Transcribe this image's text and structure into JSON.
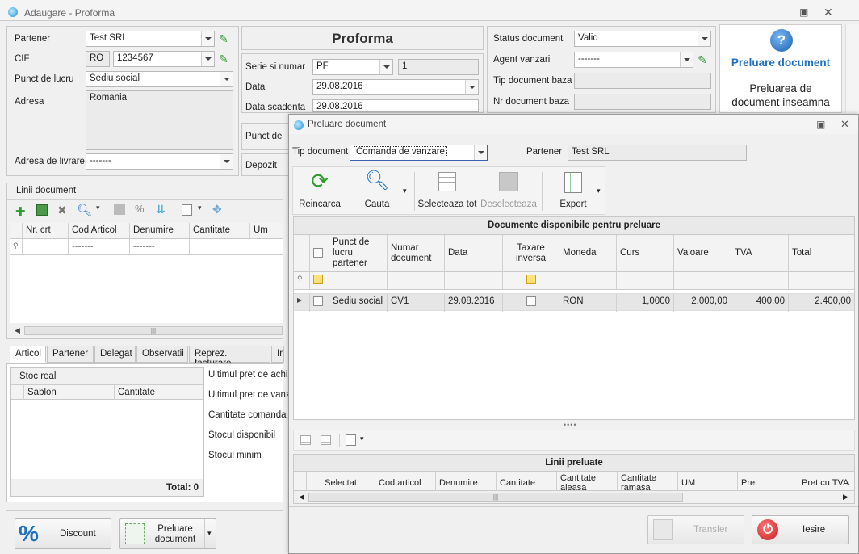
{
  "main": {
    "title": "Adaugare - Proforma",
    "partener_label": "Partener",
    "partener_value": "Test SRL",
    "cif_label": "CIF",
    "cif_prefix": "RO",
    "cif_value": "1234567",
    "punct_label": "Punct de lucru",
    "punct_value": "Sediu social",
    "adresa_label": "Adresa",
    "adresa_value": "Romania",
    "livrare_label": "Adresa de livrare",
    "livrare_value": "-------",
    "doc_title": "Proforma",
    "serie_label": "Serie si numar",
    "serie_value": "PF",
    "numar_value": "1",
    "data_label": "Data",
    "data_value": "29.08.2016",
    "scadenta_label": "Data scadenta",
    "scadenta_value": "29.08.2016",
    "punct_de_label": "Punct de",
    "depozit_label": "Depozit",
    "status_label": "Status document",
    "status_value": "Valid",
    "agent_label": "Agent vanzari",
    "agent_value": "-------",
    "tip_baza_label": "Tip document baza",
    "nr_baza_label": "Nr document baza",
    "help_title": "Preluare document",
    "help_text_1": "Preluarea de",
    "help_text_2": "document inseamna",
    "linii_label": "Linii document",
    "grid_cols": [
      "Nr. crt",
      "Cod Articol",
      "Denumire",
      "Cantitate",
      "Um"
    ],
    "grid_filter": [
      "-------",
      "-------"
    ],
    "tabs": [
      "Articol",
      "Partener",
      "Delegat",
      "Observatii",
      "Reprez. facturare",
      "Ir"
    ],
    "stoc_real": "Stoc real",
    "stoc_cols": [
      "Sablon",
      "Cantitate"
    ],
    "total_label": "Total: 0",
    "info_labels": [
      "Ultimul pret de achiz",
      "Ultimul pret de vanz",
      "Cantitate comanda",
      "Stocul disponibil",
      "Stocul minim"
    ],
    "discount_label": "Discount",
    "preluare_btn_1": "Preluare",
    "preluare_btn_2": "document"
  },
  "dialog": {
    "title": "Preluare document",
    "tip_label": "Tip document",
    "tip_value": "Comanda de vanzare",
    "partener_label": "Partener",
    "partener_value": "Test SRL",
    "toolbar": [
      "Reincarca",
      "Cauta",
      "Selecteaza tot",
      "Deselecteaza",
      "Export"
    ],
    "grid_title": "Documente disponibile pentru preluare",
    "cols": [
      "Punct de lucru partener",
      "Numar document",
      "Data",
      "Taxare inversa",
      "Moneda",
      "Curs",
      "Valoare",
      "TVA",
      "Total"
    ],
    "row": {
      "punct": "Sediu social",
      "numar": "CV1",
      "data": "29.08.2016",
      "moneda": "RON",
      "curs": "1,0000",
      "valoare": "2.000,00",
      "tva": "400,00",
      "total": "2.400,00"
    },
    "linii_title": "Linii preluate",
    "linii_cols": [
      "Selectat",
      "Cod articol",
      "Denumire",
      "Cantitate",
      "Cantitate aleasa",
      "Cantitate ramasa",
      "UM",
      "Pret",
      "Pret cu TVA"
    ],
    "transfer_label": "Transfer",
    "iesire_label": "Iesire"
  },
  "colors": {
    "accent": "#1f6fc0",
    "green": "#2f9a2f",
    "red": "#d62a2a"
  }
}
